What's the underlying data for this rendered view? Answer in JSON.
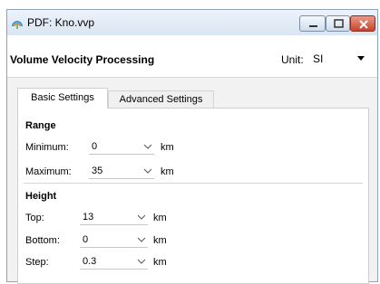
{
  "window": {
    "title": "PDF: Kno.vvp"
  },
  "header": {
    "title": "Volume Velocity Processing",
    "unit_label": "Unit:",
    "unit_value": "SI"
  },
  "tabs": [
    {
      "label": "Basic Settings",
      "active": true
    },
    {
      "label": "Advanced Settings",
      "active": false
    }
  ],
  "range": {
    "title": "Range",
    "minimum": {
      "label": "Minimum:",
      "value": "0",
      "unit": "km"
    },
    "maximum": {
      "label": "Maximum:",
      "value": "35",
      "unit": "km"
    }
  },
  "height": {
    "title": "Height",
    "top": {
      "label": "Top:",
      "value": "13",
      "unit": "km"
    },
    "bottom": {
      "label": "Bottom:",
      "value": "0",
      "unit": "km"
    },
    "step": {
      "label": "Step:",
      "value": "0.3",
      "unit": "km"
    }
  },
  "colors": {
    "titlebar": "#d9e5f2",
    "close_button": "#c6452c",
    "accent": "#3a7bd5"
  },
  "icons": [
    "app-icon",
    "minimize-icon",
    "maximize-icon",
    "close-icon",
    "chevron-down-icon"
  ]
}
